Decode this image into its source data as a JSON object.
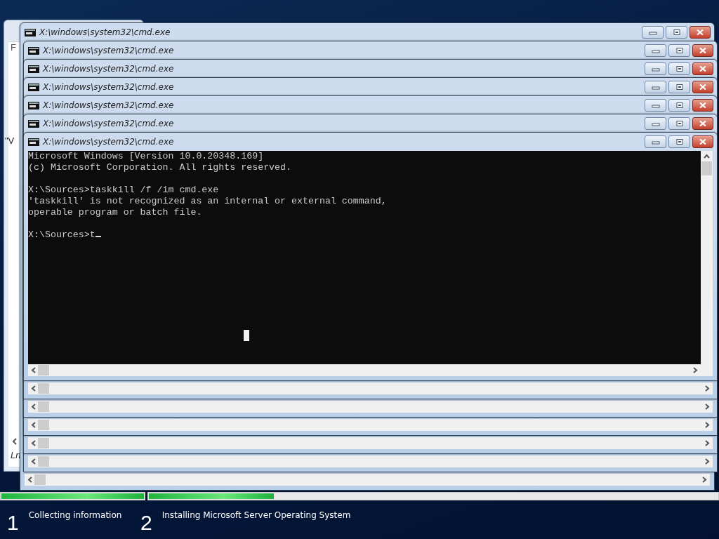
{
  "background_window": {
    "fragments": [
      "F",
      "\"V",
      "Ln"
    ]
  },
  "cmd_windows": [
    {
      "title": "X:\\windows\\system32\\cmd.exe"
    },
    {
      "title": "X:\\windows\\system32\\cmd.exe"
    },
    {
      "title": "X:\\windows\\system32\\cmd.exe"
    },
    {
      "title": "X:\\windows\\system32\\cmd.exe"
    },
    {
      "title": "X:\\windows\\system32\\cmd.exe"
    },
    {
      "title": "X:\\windows\\system32\\cmd.exe"
    },
    {
      "title": "X:\\windows\\system32\\cmd.exe"
    }
  ],
  "console": {
    "blocks": [
      [
        "Microsoft Windows [Version 10.0.20348.169]",
        "(c) Microsoft Corporation. All rights reserved."
      ],
      [
        "X:\\Sources>taskkill /f /im cmd.exe",
        "'taskkill' is not recognized as an internal or external command,",
        "operable program or batch file."
      ]
    ],
    "prompt": "X:\\Sources>t"
  },
  "setup_steps": [
    {
      "number": "1",
      "label": "Collecting information",
      "level": 1
    },
    {
      "number": "2",
      "label": "Installing Microsoft Server Operating System",
      "level": 0.22
    }
  ]
}
